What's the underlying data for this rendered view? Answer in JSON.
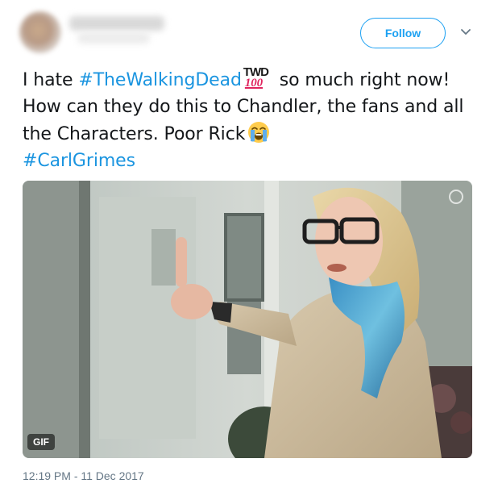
{
  "header": {
    "follow_label": "Follow"
  },
  "tweet": {
    "text_part1": "I hate ",
    "hashtag1": "#TheWalkingDead",
    "emoji_twd": {
      "top": "TWD",
      "bottom": "100"
    },
    "text_part2": " so much right now! How can they do this to Chandler, the fans and all the Characters. Poor Rick",
    "hashtag2": "#CarlGrimes"
  },
  "media": {
    "badge": "GIF"
  },
  "timestamp": "12:19 PM - 11 Dec 2017",
  "colors": {
    "link": "#1b95e0",
    "follow": "#1da1f2",
    "meta": "#657786"
  },
  "icons": {
    "caret": "chevron-down-icon",
    "cry": "loudly-crying-face-icon"
  }
}
